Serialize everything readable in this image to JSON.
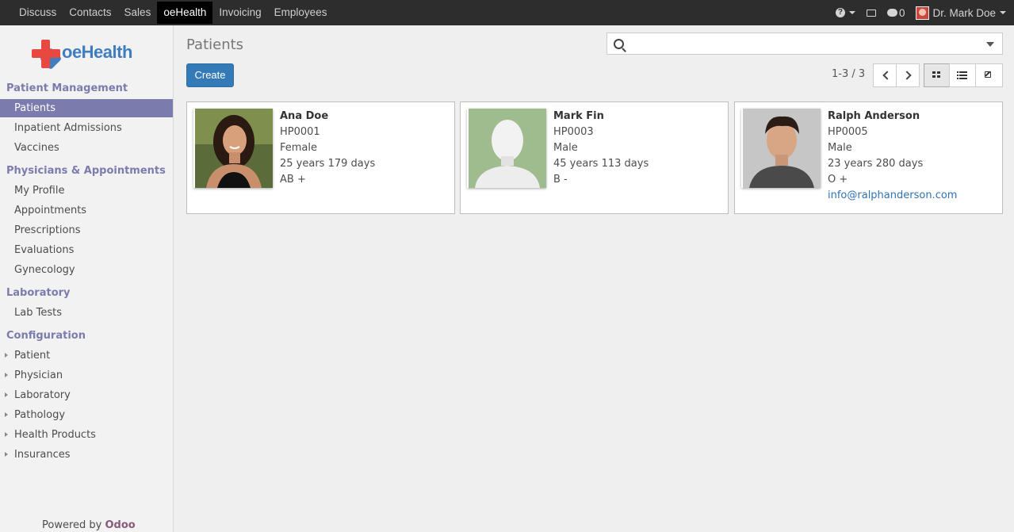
{
  "topbar": {
    "apps": [
      "Discuss",
      "Contacts",
      "Sales",
      "oeHealth",
      "Invoicing",
      "Employees"
    ],
    "active_app": "oeHealth",
    "messages_count": "0",
    "user_name": "Dr. Mark Doe"
  },
  "sidebar": {
    "logo_text": "oeHealth",
    "sections": [
      {
        "title": "Patient Management",
        "items": [
          "Patients",
          "Inpatient Admissions",
          "Vaccines"
        ]
      },
      {
        "title": "Physicians & Appointments",
        "items": [
          "My Profile",
          "Appointments",
          "Prescriptions",
          "Evaluations",
          "Gynecology"
        ]
      },
      {
        "title": "Laboratory",
        "items": [
          "Lab Tests"
        ]
      },
      {
        "title": "Configuration",
        "items": [
          "Patient",
          "Physician",
          "Laboratory",
          "Pathology",
          "Health Products",
          "Insurances"
        ]
      }
    ],
    "active_item": "Patients",
    "powered_by": "Powered by",
    "powered_brand": "Odoo"
  },
  "main": {
    "title": "Patients",
    "create_label": "Create",
    "pager": "1-3 / 3",
    "search_value": ""
  },
  "patients": [
    {
      "name": "Ana Doe",
      "code": "HP0001",
      "sex": "Female",
      "age": "25 years 179 days",
      "blood": "AB +",
      "email": ""
    },
    {
      "name": "Mark Fin",
      "code": "HP0003",
      "sex": "Male",
      "age": "45 years 113 days",
      "blood": "B -",
      "email": ""
    },
    {
      "name": "Ralph Anderson",
      "code": "HP0005",
      "sex": "Male",
      "age": "23 years 280 days",
      "blood": "O +",
      "email": "info@ralphanderson.com"
    }
  ],
  "colors": {
    "topbar_bg": "#2d2d2d",
    "sidebar_accent": "#7c7bad",
    "primary_button": "#337ab7",
    "link": "#2f72b4",
    "brand_red": "#e8483f",
    "brand_blue": "#3f7dbf"
  },
  "icons": [
    "help-icon",
    "mail-icon",
    "chat-icon",
    "search-icon",
    "chevron-left-icon",
    "chevron-right-icon",
    "kanban-view-icon",
    "list-view-icon",
    "form-view-icon"
  ]
}
